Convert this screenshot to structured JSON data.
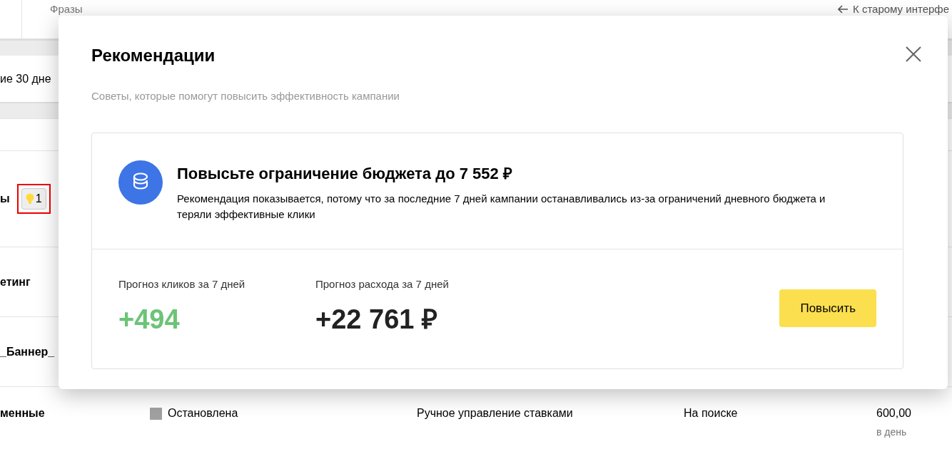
{
  "top_bar": {
    "tab": "Фразы",
    "back_link": "К старому интерфе"
  },
  "table": {
    "header": {
      "column_1": "ие 30 дне"
    },
    "rows": [
      {
        "name": "ы",
        "badge": "1",
        "highlighted": true
      },
      {
        "name": "етинг"
      },
      {
        "name": "_Баннер_"
      },
      {
        "name": "менные",
        "status": "Остановлена",
        "color": "#a0a0a0",
        "strategy": "Ручное управление ставками",
        "placement": "На поиске",
        "budget": "600,00",
        "budget_period": "в день"
      }
    ]
  },
  "modal": {
    "title": "Рекомендации",
    "subtitle": "Советы, которые помогут повысить эффективность кампании",
    "recommendation": {
      "heading": "Повысьте ограничение бюджета до 7 552 ₽",
      "description": "Рекомендация показывается, потому что за последние 7 дней кампании останавливались из-за ограничений дневного бюджета и теряли эффективные клики",
      "metrics": [
        {
          "label": "Прогноз кликов за 7 дней",
          "value": "+494",
          "kind": "positive"
        },
        {
          "label": "Прогноз расхода за 7 дней",
          "value": "+22 761 ₽",
          "kind": "neutral"
        }
      ],
      "button": "Повысить"
    }
  }
}
